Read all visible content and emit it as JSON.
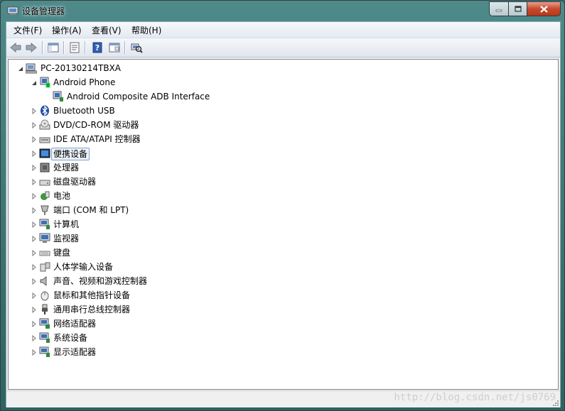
{
  "window": {
    "title": "设备管理器"
  },
  "menu": {
    "items": [
      "文件(F)",
      "操作(A)",
      "查看(V)",
      "帮助(H)"
    ]
  },
  "toolbar": {
    "buttons": [
      "back-icon",
      "forward-icon",
      "show-hide-tree-icon",
      "properties-icon",
      "help-icon",
      "view-icon",
      "scan-hardware-icon"
    ]
  },
  "tree": {
    "root": "PC-20130214TBXA",
    "items": [
      {
        "label": "Android Phone",
        "level": 1,
        "expanded": true,
        "icon": "phone-device-icon"
      },
      {
        "label": "Android Composite ADB Interface",
        "level": 2,
        "expanded": null,
        "icon": "adb-interface-icon"
      },
      {
        "label": "Bluetooth USB",
        "level": 1,
        "expanded": false,
        "icon": "bluetooth-icon"
      },
      {
        "label": "DVD/CD-ROM 驱动器",
        "level": 1,
        "expanded": false,
        "icon": "dvd-drive-icon"
      },
      {
        "label": "IDE ATA/ATAPI 控制器",
        "level": 1,
        "expanded": false,
        "icon": "ide-controller-icon"
      },
      {
        "label": "便携设备",
        "level": 1,
        "expanded": false,
        "icon": "portable-device-icon",
        "selected": true
      },
      {
        "label": "处理器",
        "level": 1,
        "expanded": false,
        "icon": "processor-icon"
      },
      {
        "label": "磁盘驱动器",
        "level": 1,
        "expanded": false,
        "icon": "disk-drive-icon"
      },
      {
        "label": "电池",
        "level": 1,
        "expanded": false,
        "icon": "battery-icon"
      },
      {
        "label": "端口 (COM 和 LPT)",
        "level": 1,
        "expanded": false,
        "icon": "port-icon"
      },
      {
        "label": "计算机",
        "level": 1,
        "expanded": false,
        "icon": "computer-icon"
      },
      {
        "label": "监视器",
        "level": 1,
        "expanded": false,
        "icon": "monitor-icon"
      },
      {
        "label": "键盘",
        "level": 1,
        "expanded": false,
        "icon": "keyboard-icon"
      },
      {
        "label": "人体学输入设备",
        "level": 1,
        "expanded": false,
        "icon": "hid-icon"
      },
      {
        "label": "声音、视频和游戏控制器",
        "level": 1,
        "expanded": false,
        "icon": "sound-icon"
      },
      {
        "label": "鼠标和其他指针设备",
        "level": 1,
        "expanded": false,
        "icon": "mouse-icon"
      },
      {
        "label": "通用串行总线控制器",
        "level": 1,
        "expanded": false,
        "icon": "usb-icon"
      },
      {
        "label": "网络适配器",
        "level": 1,
        "expanded": false,
        "icon": "network-adapter-icon"
      },
      {
        "label": "系统设备",
        "level": 1,
        "expanded": false,
        "icon": "system-device-icon"
      },
      {
        "label": "显示适配器",
        "level": 1,
        "expanded": false,
        "icon": "display-adapter-icon"
      }
    ]
  },
  "status": {
    "watermark": "http://blog.csdn.net/js0769"
  }
}
